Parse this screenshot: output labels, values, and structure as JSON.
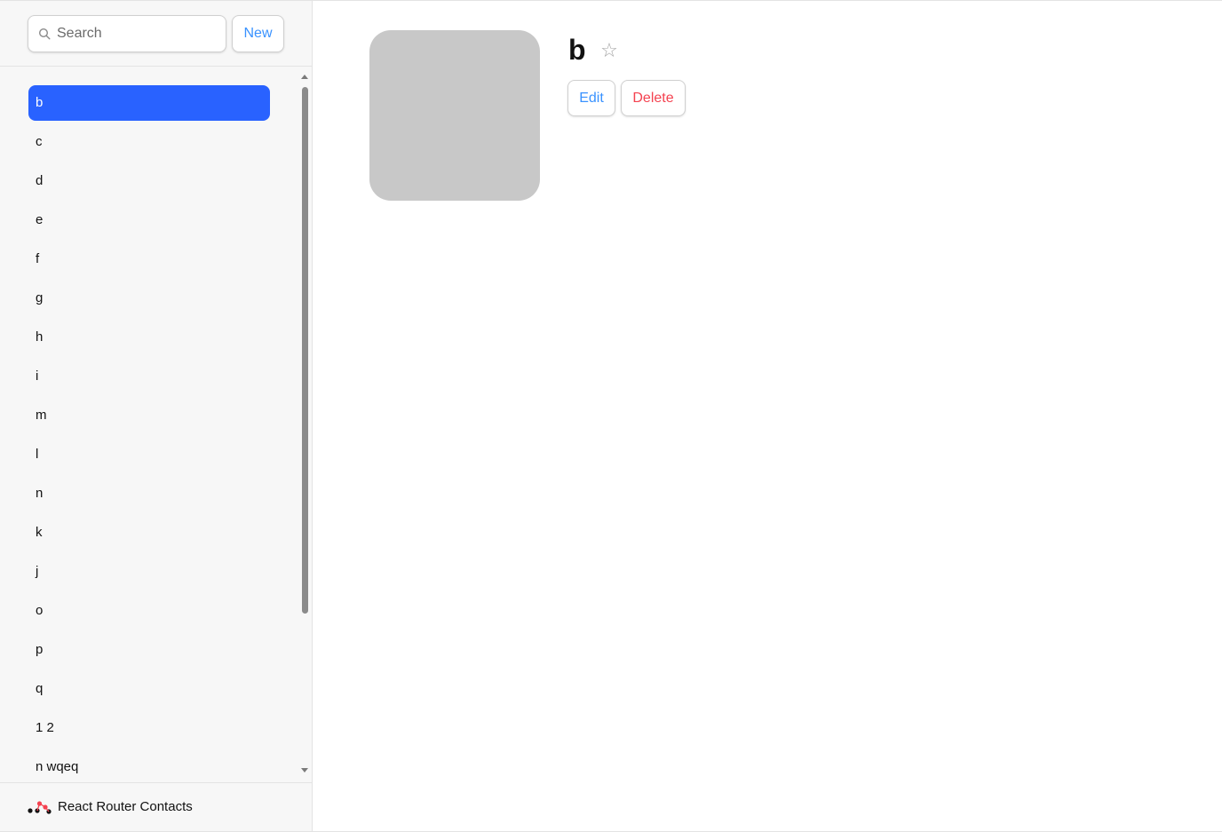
{
  "sidebar": {
    "search": {
      "placeholder": "Search",
      "value": ""
    },
    "new_label": "New",
    "items": [
      {
        "label": "b",
        "active": true
      },
      {
        "label": "c"
      },
      {
        "label": "d"
      },
      {
        "label": "e"
      },
      {
        "label": "f"
      },
      {
        "label": "g"
      },
      {
        "label": "h"
      },
      {
        "label": "i"
      },
      {
        "label": "m"
      },
      {
        "label": "l"
      },
      {
        "label": "n"
      },
      {
        "label": "k"
      },
      {
        "label": "j"
      },
      {
        "label": "o"
      },
      {
        "label": "p"
      },
      {
        "label": "q"
      },
      {
        "label": "1 2"
      },
      {
        "label": "n wqeq"
      }
    ],
    "footer_title": "React Router Contacts"
  },
  "contact": {
    "name": "b",
    "favorite_icon": "☆",
    "edit_label": "Edit",
    "delete_label": "Delete"
  },
  "colors": {
    "accent": "#3992ff",
    "active": "#2962ff",
    "danger": "#f44250",
    "avatar_placeholder": "#c8c8c8"
  }
}
